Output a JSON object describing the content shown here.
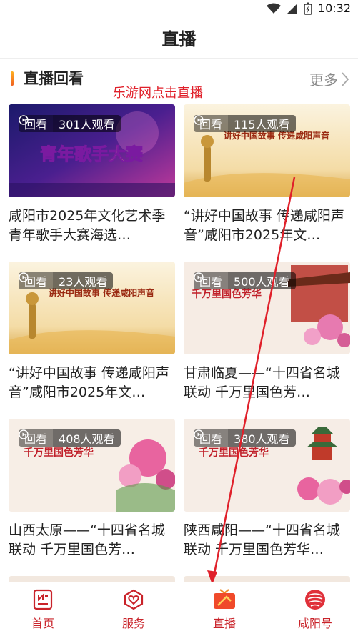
{
  "status": {
    "time": "10:32",
    "icons": [
      "wifi-icon",
      "signal-icon",
      "battery-icon"
    ]
  },
  "header": {
    "title": "直播"
  },
  "section": {
    "title": "直播回看",
    "more": "更多"
  },
  "overlay_text": "乐游网点击直播",
  "colors": {
    "accent": "#c9232a",
    "badge_bg": "rgba(0,0,0,0.5)",
    "watermark": "#e0202a"
  },
  "cards": [
    {
      "badge_label": "回看",
      "count": "301人观看",
      "title": "咸阳市2025年文化艺术季青年歌手大赛海选…",
      "thumb_text": "青年歌手大赛"
    },
    {
      "badge_label": "回看",
      "count": "115人观看",
      "title": "“讲好中国故事 传递咸阳声音”咸阳市2025年文…",
      "thumb_text": "讲好中国故事 传递咸阳声音"
    },
    {
      "badge_label": "回看",
      "count": "23人观看",
      "title": "“讲好中国故事 传递咸阳声音”咸阳市2025年文…",
      "thumb_text": "讲好中国故事 传递咸阳声音"
    },
    {
      "badge_label": "回看",
      "count": "500人观看",
      "title": "甘肃临夏——“十四省名城联动 千万里国色芳…",
      "thumb_text": "千万里国色芳华"
    },
    {
      "badge_label": "回看",
      "count": "408人观看",
      "title": "山西太原——“十四省名城联动 千万里国色芳…",
      "thumb_text": "千万里国色芳华"
    },
    {
      "badge_label": "回看",
      "count": "380人观看",
      "title": "陕西咸阳——“十四省名城联动 千万里国色芳华…",
      "thumb_text": "千万里国色芳华"
    }
  ],
  "tabs": [
    {
      "label": "首页",
      "icon": "home-news-icon"
    },
    {
      "label": "服务",
      "icon": "service-heart-icon"
    },
    {
      "label": "直播",
      "icon": "live-tv-icon",
      "active": true
    },
    {
      "label": "咸阳号",
      "icon": "xianyang-logo-icon"
    }
  ]
}
